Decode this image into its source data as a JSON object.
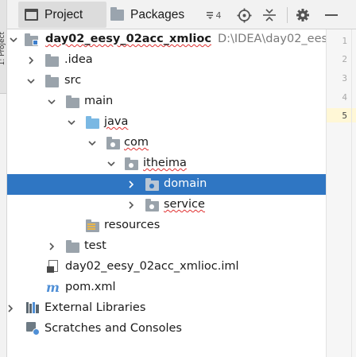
{
  "left_strip": {
    "label": "1: Project"
  },
  "toolbar": {
    "tabs": [
      {
        "label": "Project",
        "icon": "project-icon",
        "active": true
      },
      {
        "label": "Packages",
        "icon": "packages-icon",
        "active": false
      }
    ],
    "menu_count": "4",
    "buttons": [
      "locate-icon",
      "collapse-all-icon",
      "gear-icon",
      "hide-icon"
    ]
  },
  "tree": {
    "root": {
      "name": "day02_eesy_02acc_xmlioc",
      "path": "D:\\IDEA\\day02_eesy_02a"
    },
    "items": [
      {
        "label": ".idea",
        "icon": "folder-icon"
      },
      {
        "label": "src",
        "icon": "folder-icon"
      },
      {
        "label": "main",
        "icon": "folder-icon"
      },
      {
        "label": "java",
        "icon": "source-folder-icon"
      },
      {
        "label": "com",
        "icon": "package-icon"
      },
      {
        "label": "itheima",
        "icon": "package-icon"
      },
      {
        "label": "domain",
        "icon": "package-icon",
        "selected": true
      },
      {
        "label": "service",
        "icon": "package-icon"
      },
      {
        "label": "resources",
        "icon": "resources-folder-icon"
      },
      {
        "label": "test",
        "icon": "folder-icon"
      },
      {
        "label": "day02_eesy_02acc_xmlioc.iml",
        "icon": "iml-file-icon"
      },
      {
        "label": "pom.xml",
        "icon": "maven-icon"
      },
      {
        "label": "External Libraries",
        "icon": "libraries-icon"
      },
      {
        "label": "Scratches and Consoles",
        "icon": "scratches-icon"
      }
    ]
  },
  "gutter": {
    "line_numbers": [
      "1",
      "2",
      "3",
      "4",
      "5"
    ],
    "active_line": "5"
  },
  "colors": {
    "selection": "#2f76c3",
    "folder_blue": "#7ab8e3",
    "folder_gray": "#9aa3ab",
    "error_underline": "#e03030"
  }
}
